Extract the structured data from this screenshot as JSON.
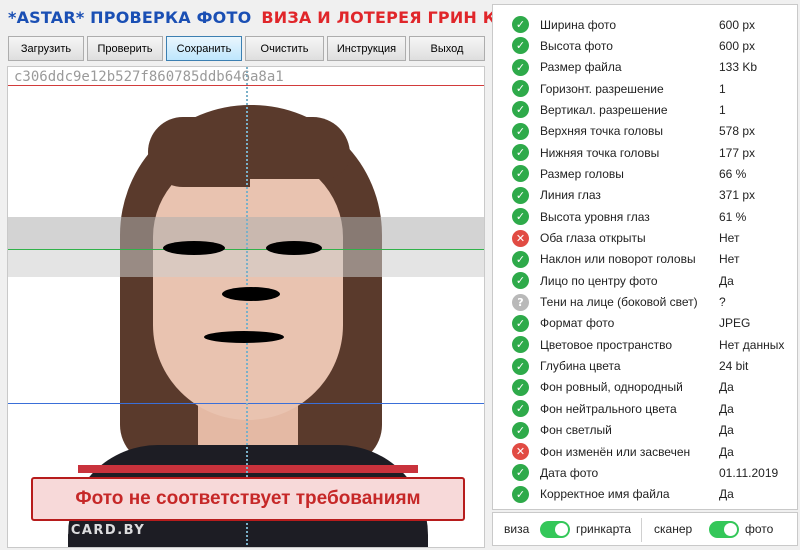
{
  "header": {
    "brand": "*ASTAR* ПРОВЕРКА ФОТО",
    "subtitle": "ВИЗА И ЛОТЕРЕЯ ГРИН КАРТА"
  },
  "toolbar": {
    "load": "Загрузить",
    "check": "Проверить",
    "save": "Сохранить",
    "clear": "Очистить",
    "instructions": "Инструкция",
    "exit": "Выход"
  },
  "photo": {
    "hash": "c306ddc9e12b527f860785ddb646a8a1",
    "warning": "Фото не соответствует требованиям",
    "watermark": "GREENCARD.BY"
  },
  "checks": [
    {
      "label": "Ширина фото",
      "value": "600 px",
      "status": "ok"
    },
    {
      "label": "Высота фото",
      "value": "600 px",
      "status": "ok"
    },
    {
      "label": "Размер файла",
      "value": "133 Kb",
      "status": "ok"
    },
    {
      "label": "Горизонт. разрешение",
      "value": "1",
      "status": "ok"
    },
    {
      "label": "Вертикал. разрешение",
      "value": "1",
      "status": "ok"
    },
    {
      "label": "Верхняя точка головы",
      "value": "578 px",
      "status": "ok"
    },
    {
      "label": "Нижняя точка головы",
      "value": "177 px",
      "status": "ok"
    },
    {
      "label": "Размер головы",
      "value": "66 %",
      "status": "ok"
    },
    {
      "label": "Линия глаз",
      "value": "371 px",
      "status": "ok"
    },
    {
      "label": "Высота уровня глаз",
      "value": "61 %",
      "status": "ok"
    },
    {
      "label": "Оба глаза открыты",
      "value": "Нет",
      "status": "bad"
    },
    {
      "label": "Наклон или поворот головы",
      "value": "Нет",
      "status": "ok"
    },
    {
      "label": "Лицо по центру фото",
      "value": "Да",
      "status": "ok"
    },
    {
      "label": "Тени на лице (боковой свет)",
      "value": "?",
      "status": "unknown"
    },
    {
      "label": "Формат фото",
      "value": "JPEG",
      "status": "ok"
    },
    {
      "label": "Цветовое пространство",
      "value": "Нет данных",
      "status": "ok"
    },
    {
      "label": "Глубина цвета",
      "value": "24 bit",
      "status": "ok"
    },
    {
      "label": "Фон ровный, однородный",
      "value": "Да",
      "status": "ok"
    },
    {
      "label": "Фон нейтрального цвета",
      "value": "Да",
      "status": "ok"
    },
    {
      "label": "Фон светлый",
      "value": "Да",
      "status": "ok"
    },
    {
      "label": "Фон изменён или засвечен",
      "value": "Да",
      "status": "bad"
    },
    {
      "label": "Дата фото",
      "value": "01.11.2019",
      "status": "ok"
    },
    {
      "label": "Корректное имя файла",
      "value": "Да",
      "status": "ok"
    }
  ],
  "icons": {
    "ok": "check-circle-icon",
    "bad": "x-circle-icon",
    "unknown": "question-circle-icon"
  },
  "toggles": {
    "left_label": "виза",
    "left_right_label": "гринкарта",
    "left_on": true,
    "right_label": "сканер",
    "right_right_label": "фото",
    "right_on": true
  },
  "colors": {
    "brand_blue": "#1a4fb4",
    "brand_red": "#e0262a",
    "ok": "#2eaa4a",
    "bad": "#e14b43",
    "unknown": "#b9b9b9",
    "switch_on": "#34c759",
    "top_line": "#d23b3b",
    "eye_line": "#31b24a",
    "chin_line": "#3a6fd8"
  }
}
